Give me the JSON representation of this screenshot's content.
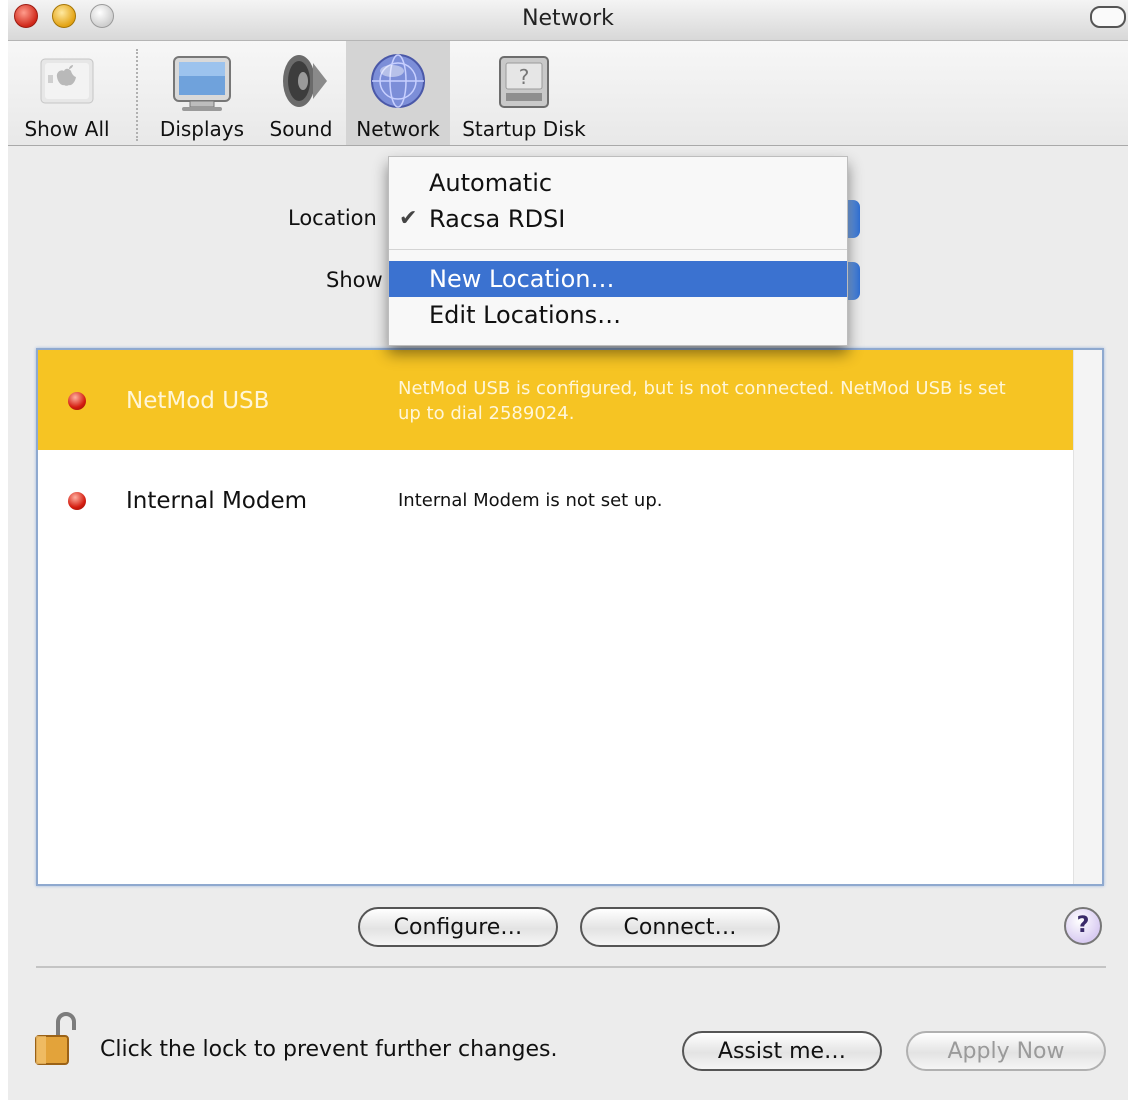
{
  "window": {
    "title": "Network"
  },
  "toolbar": {
    "items": [
      {
        "label": "Show All"
      },
      {
        "label": "Displays"
      },
      {
        "label": "Sound"
      },
      {
        "label": "Network"
      },
      {
        "label": "Startup Disk"
      }
    ]
  },
  "form": {
    "location_label": "Location",
    "show_label": "Show"
  },
  "location_menu": {
    "items": [
      {
        "label": "Automatic"
      },
      {
        "label": "Racsa RDSI",
        "checked": true
      },
      {
        "label": "New Location…",
        "highlighted": true
      },
      {
        "label": "Edit Locations…"
      }
    ],
    "checkmark": "✔"
  },
  "ports": [
    {
      "name": "NetMod USB",
      "description": "NetMod USB is configured, but is not connected. NetMod USB is set up to dial 2589024.",
      "selected": true
    },
    {
      "name": "Internal Modem",
      "description": "Internal Modem is not set up.",
      "selected": false
    }
  ],
  "buttons": {
    "configure": "Configure…",
    "connect": "Connect…",
    "help": "?",
    "assist": "Assist me…",
    "apply": "Apply Now"
  },
  "lock": {
    "text": "Click the lock to prevent further changes."
  },
  "colors": {
    "selection_yellow": "#f6c423",
    "menu_highlight": "#3b72d0"
  }
}
